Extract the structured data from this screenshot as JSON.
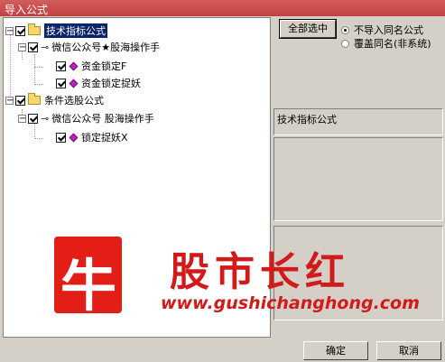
{
  "window": {
    "title": "导入公式"
  },
  "tree": {
    "root1": {
      "label": "技术指标公式"
    },
    "group1": {
      "label": "微信公众号★股海操作手"
    },
    "item1": {
      "label": "资金锁定F"
    },
    "item2": {
      "label": "资金锁定捉妖"
    },
    "root2": {
      "label": "条件选股公式"
    },
    "group2": {
      "label": "微信公众号 股海操作手"
    },
    "item3": {
      "label": "锁定捉妖X"
    }
  },
  "options": {
    "select_all": "全部选中",
    "no_import_same": "不导入同名公式",
    "overwrite_same": "覆盖同名(非系统)",
    "selected_option": "no_import_same"
  },
  "info": {
    "type_label": "技术指标公式"
  },
  "watermark": {
    "glyph": "牛",
    "name": "股市长红",
    "url": "www.gushichanghong.com"
  },
  "footer": {
    "ok": "确定",
    "cancel": "取消"
  },
  "colors": {
    "titlebar": "#c04242",
    "selection": "#0a246a",
    "watermark": "#d11b1b",
    "gem": "#c41fc4"
  }
}
